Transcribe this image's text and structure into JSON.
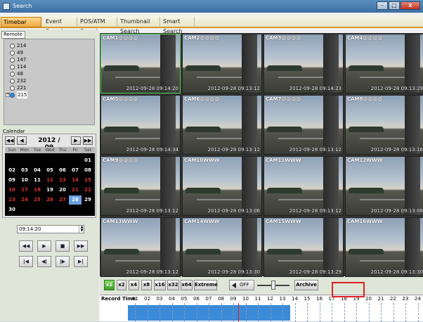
{
  "window": {
    "title": "Search",
    "minimize": "–",
    "maximize": "□",
    "close": "x",
    "icon": "app-icon"
  },
  "tabs": [
    "Timebar Search",
    "Event Search",
    "POS/ATM Search",
    "Thumbnail Search",
    "Smart Search"
  ],
  "left": {
    "remote_tab": "Remote",
    "devices": [
      "214",
      "49",
      "147",
      "114",
      "48",
      "232",
      "221",
      "215"
    ],
    "expander": "+",
    "calendar": {
      "label": "Calendar",
      "month": "2012 / 09",
      "nav_prev_year": "◀◀",
      "nav_prev": "◀",
      "nav_next": "▶",
      "nav_next_year": "▶▶",
      "weekdays": [
        "Sun",
        "Mon",
        "Tue",
        "Wed",
        "Thu",
        "Fri",
        "Sat"
      ],
      "rows": [
        [
          "",
          "",
          "",
          "",
          "",
          "",
          "01"
        ],
        [
          "02",
          "03",
          "04",
          "05",
          "06",
          "07",
          "08"
        ],
        [
          "09",
          "10",
          "11",
          "12",
          "13",
          "14",
          "15"
        ],
        [
          "16",
          "17",
          "18",
          "19",
          "20",
          "21",
          "22"
        ],
        [
          "23",
          "24",
          "25",
          "26",
          "27",
          "28",
          "29"
        ],
        [
          "30",
          "",
          "",
          "",
          "",
          "",
          ""
        ]
      ],
      "selected": "28"
    },
    "time_value": "09:14:20",
    "playback_row1": [
      "◀◀",
      "▶",
      "■",
      "▶▶"
    ],
    "playback_row2": [
      "|◀",
      "◀|",
      "|▶",
      "▶|"
    ]
  },
  "cameras": [
    {
      "name": "CAM1@@@@",
      "time": "2012-09-28 09:14:20",
      "selected": true
    },
    {
      "name": "CAM2@@@@",
      "time": "2012-09-28 09:13:12"
    },
    {
      "name": "CAM3@@@@",
      "time": "2012-09-28 09:14:23"
    },
    {
      "name": "CAM4@@@@",
      "time": "2012-09-28 09:13:29"
    },
    {
      "name": "CAM5@@@@",
      "time": "2012-09-28 09:14:34"
    },
    {
      "name": "CAM6@@@@",
      "time": "2012-09-28 09:13:12"
    },
    {
      "name": "CAM7@@@@",
      "time": "2012-09-28 09:13:12"
    },
    {
      "name": "CAM8@@@@",
      "time": "2012-09-28 09:13:16"
    },
    {
      "name": "CAM9@@@@",
      "time": "2012-09-28 09:13:12"
    },
    {
      "name": "CAM10WWW",
      "time": "2012-09-28 09:13:06"
    },
    {
      "name": "CAM11WWW",
      "time": "2012-09-28 09:13:12"
    },
    {
      "name": "CAM12WWW",
      "time": "2012-09-28 09:13:08"
    },
    {
      "name": "CAM13WWW",
      "time": "2012-09-28 09:13:12"
    },
    {
      "name": "CAM14WWW",
      "time": "2012-09-28 09:13:30"
    },
    {
      "name": "CAM15WWW",
      "time": "2012-09-28 09:13:29"
    },
    {
      "name": "CAM16WWW",
      "time": "2012-09-28 09:13:30"
    }
  ],
  "controls": {
    "speeds": [
      "x1",
      "x2",
      "x4",
      "x8",
      "x16",
      "x32",
      "x64",
      "Extreme"
    ],
    "active_speed": "x1",
    "audio": "OFF",
    "archive": "Archive"
  },
  "timeline": {
    "label": "Record Time",
    "hours": [
      "01",
      "02",
      "03",
      "04",
      "05",
      "06",
      "07",
      "08",
      "09",
      "10",
      "11",
      "12",
      "13",
      "14",
      "15",
      "16",
      "17",
      "18",
      "19",
      "20",
      "21",
      "22",
      "23",
      "24"
    ],
    "record_color": "#3a8ad8",
    "cursor_color": "#e02020"
  }
}
